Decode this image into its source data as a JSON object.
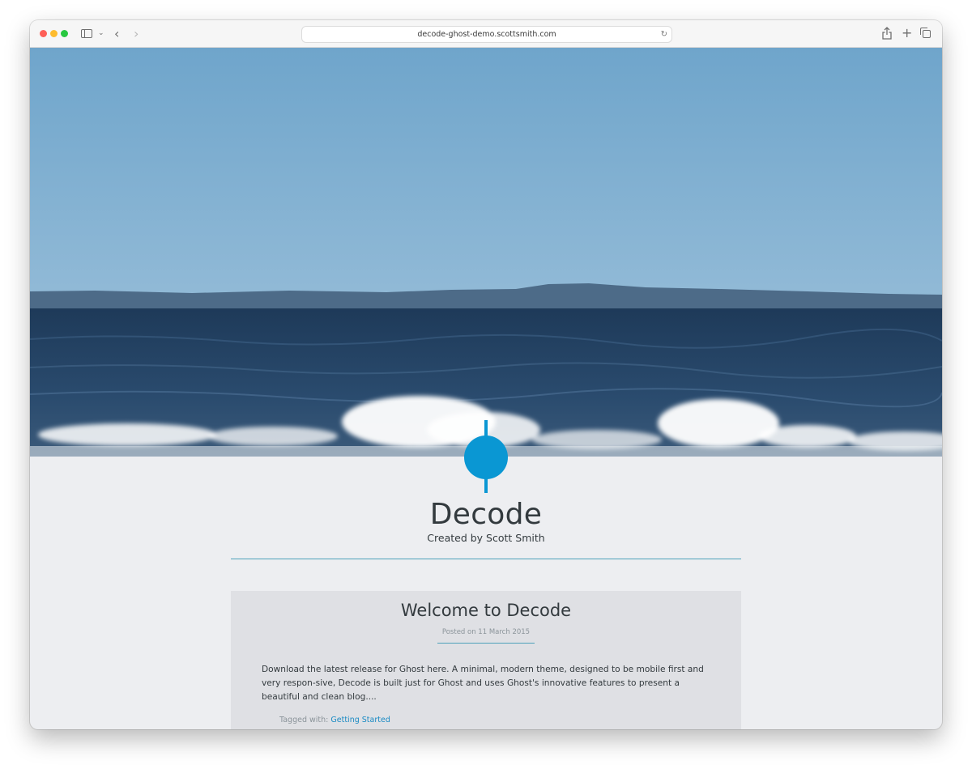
{
  "browser": {
    "url": "decode-ghost-demo.scottsmith.com"
  },
  "site": {
    "title": "Decode",
    "description": "Created by Scott Smith",
    "accent_color": "#0a97d3"
  },
  "post": {
    "title": "Welcome to Decode",
    "date_label": "Posted on 11 March 2015",
    "excerpt": "Download the latest release for Ghost here. A minimal, modern theme, designed to be mobile first and very respon-sive, Decode is built just for Ghost and uses Ghost's innovative features to present a beautiful and clean blog....",
    "tags_label": "Tagged with:",
    "tag": "Getting Started"
  }
}
